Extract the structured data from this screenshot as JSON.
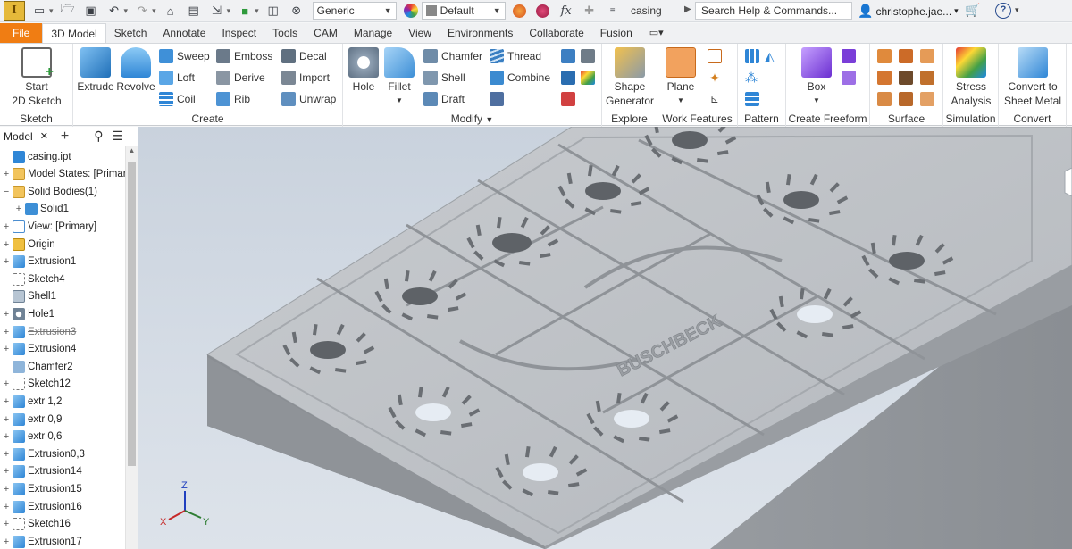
{
  "app": {
    "logo_letter": "I",
    "document_title": "casing"
  },
  "quick_access": {
    "appearance_combo": "Generic",
    "material_combo": "Default",
    "search_placeholder": "Search Help & Commands...",
    "user_name": "christophe.jae...",
    "help_label": "?"
  },
  "tabs": [
    {
      "label": "File"
    },
    {
      "label": "3D Model"
    },
    {
      "label": "Sketch"
    },
    {
      "label": "Annotate"
    },
    {
      "label": "Inspect"
    },
    {
      "label": "Tools"
    },
    {
      "label": "CAM"
    },
    {
      "label": "Manage"
    },
    {
      "label": "View"
    },
    {
      "label": "Environments"
    },
    {
      "label": "Collaborate"
    },
    {
      "label": "Fusion"
    }
  ],
  "ribbon": {
    "sketch": {
      "start_line1": "Start",
      "start_line2": "2D Sketch",
      "panel": "Sketch"
    },
    "create": {
      "extrude": "Extrude",
      "revolve": "Revolve",
      "sweep": "Sweep",
      "loft": "Loft",
      "coil": "Coil",
      "emboss": "Emboss",
      "derive": "Derive",
      "rib": "Rib",
      "decal": "Decal",
      "import": "Import",
      "unwrap": "Unwrap",
      "panel": "Create"
    },
    "modify": {
      "hole": "Hole",
      "fillet": "Fillet",
      "chamfer": "Chamfer",
      "shell": "Shell",
      "draft": "Draft",
      "thread": "Thread",
      "combine": "Combine",
      "panel": "Modify"
    },
    "explore": {
      "line1": "Shape",
      "line2": "Generator",
      "panel": "Explore"
    },
    "work_features": {
      "plane": "Plane",
      "panel": "Work Features"
    },
    "pattern": {
      "panel": "Pattern"
    },
    "freeform": {
      "box": "Box",
      "panel": "Create Freeform"
    },
    "surface": {
      "panel": "Surface"
    },
    "simulation": {
      "line1": "Stress",
      "line2": "Analysis",
      "panel": "Simulation"
    },
    "convert": {
      "line1": "Convert to",
      "line2": "Sheet Metal",
      "panel": "Convert"
    }
  },
  "browser": {
    "tab_label": "Model",
    "close": "✕",
    "add": "+",
    "items": [
      {
        "label": "casing.ipt",
        "exp": "",
        "indent": 0,
        "icon": "part",
        "strike": false
      },
      {
        "label": "Model States: [Primar",
        "exp": "+",
        "indent": 0,
        "icon": "folder",
        "strike": false
      },
      {
        "label": "Solid Bodies(1)",
        "exp": "−",
        "indent": 0,
        "icon": "folder",
        "strike": false
      },
      {
        "label": "Solid1",
        "exp": "+",
        "indent": 1,
        "icon": "solid",
        "strike": false
      },
      {
        "label": "View: [Primary]",
        "exp": "+",
        "indent": 0,
        "icon": "view",
        "strike": false
      },
      {
        "label": "Origin",
        "exp": "+",
        "indent": 0,
        "icon": "origin",
        "strike": false
      },
      {
        "label": "Extrusion1",
        "exp": "+",
        "indent": 0,
        "icon": "extrude",
        "strike": false
      },
      {
        "label": "Sketch4",
        "exp": "",
        "indent": 0,
        "icon": "sketch",
        "strike": false
      },
      {
        "label": "Shell1",
        "exp": "",
        "indent": 0,
        "icon": "shell",
        "strike": false
      },
      {
        "label": "Hole1",
        "exp": "+",
        "indent": 0,
        "icon": "hole",
        "strike": false
      },
      {
        "label": "Extrusion3",
        "exp": "+",
        "indent": 0,
        "icon": "extrude",
        "strike": true
      },
      {
        "label": "Extrusion4",
        "exp": "+",
        "indent": 0,
        "icon": "extrude",
        "strike": false
      },
      {
        "label": "Chamfer2",
        "exp": "",
        "indent": 0,
        "icon": "chamfer",
        "strike": false
      },
      {
        "label": "Sketch12",
        "exp": "+",
        "indent": 0,
        "icon": "sketch",
        "strike": false
      },
      {
        "label": "extr 1,2",
        "exp": "+",
        "indent": 0,
        "icon": "extrude",
        "strike": false
      },
      {
        "label": "extr 0,9",
        "exp": "+",
        "indent": 0,
        "icon": "extrude",
        "strike": false
      },
      {
        "label": "extr 0,6",
        "exp": "+",
        "indent": 0,
        "icon": "extrude",
        "strike": false
      },
      {
        "label": "Extrusion0,3",
        "exp": "+",
        "indent": 0,
        "icon": "extrude",
        "strike": false
      },
      {
        "label": "Extrusion14",
        "exp": "+",
        "indent": 0,
        "icon": "extrude",
        "strike": false
      },
      {
        "label": "Extrusion15",
        "exp": "+",
        "indent": 0,
        "icon": "extrude",
        "strike": false
      },
      {
        "label": "Extrusion16",
        "exp": "+",
        "indent": 0,
        "icon": "extrude",
        "strike": false
      },
      {
        "label": "Sketch16",
        "exp": "+",
        "indent": 0,
        "icon": "sketch",
        "strike": false
      },
      {
        "label": "Extrusion17",
        "exp": "+",
        "indent": 0,
        "icon": "extrude",
        "strike": false
      }
    ]
  },
  "viewport": {
    "engraved_text": "BUSCHBECK",
    "triad": {
      "x": "X",
      "y": "Y",
      "z": "Z"
    }
  },
  "colors": {
    "accent": "#f07d13",
    "extrude_blue": "#2f86d6",
    "part_gray": "#a9adb2"
  }
}
